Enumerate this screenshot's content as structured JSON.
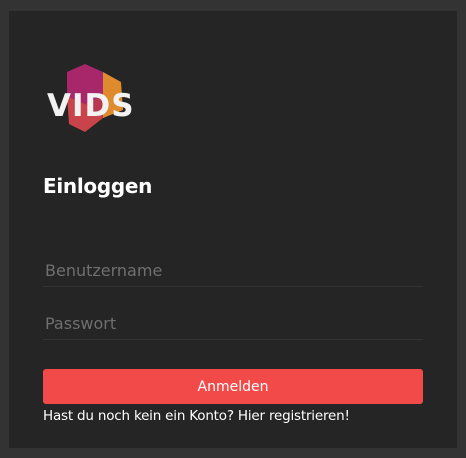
{
  "brand": {
    "logo_text": "VIDS",
    "colors": {
      "magenta": "#a8266a",
      "red": "#c9444a",
      "orange": "#e08a2e",
      "text": "#f2f2f2"
    }
  },
  "login": {
    "title": "Einloggen",
    "username_placeholder": "Benutzername",
    "password_placeholder": "Passwort",
    "submit_label": "Anmelden",
    "register_prompt": "Hast du noch kein ein Konto?",
    "register_link": "Hier registrieren!"
  },
  "theme": {
    "background": "#333333",
    "panel": "#252525",
    "accent": "#f24a48"
  }
}
